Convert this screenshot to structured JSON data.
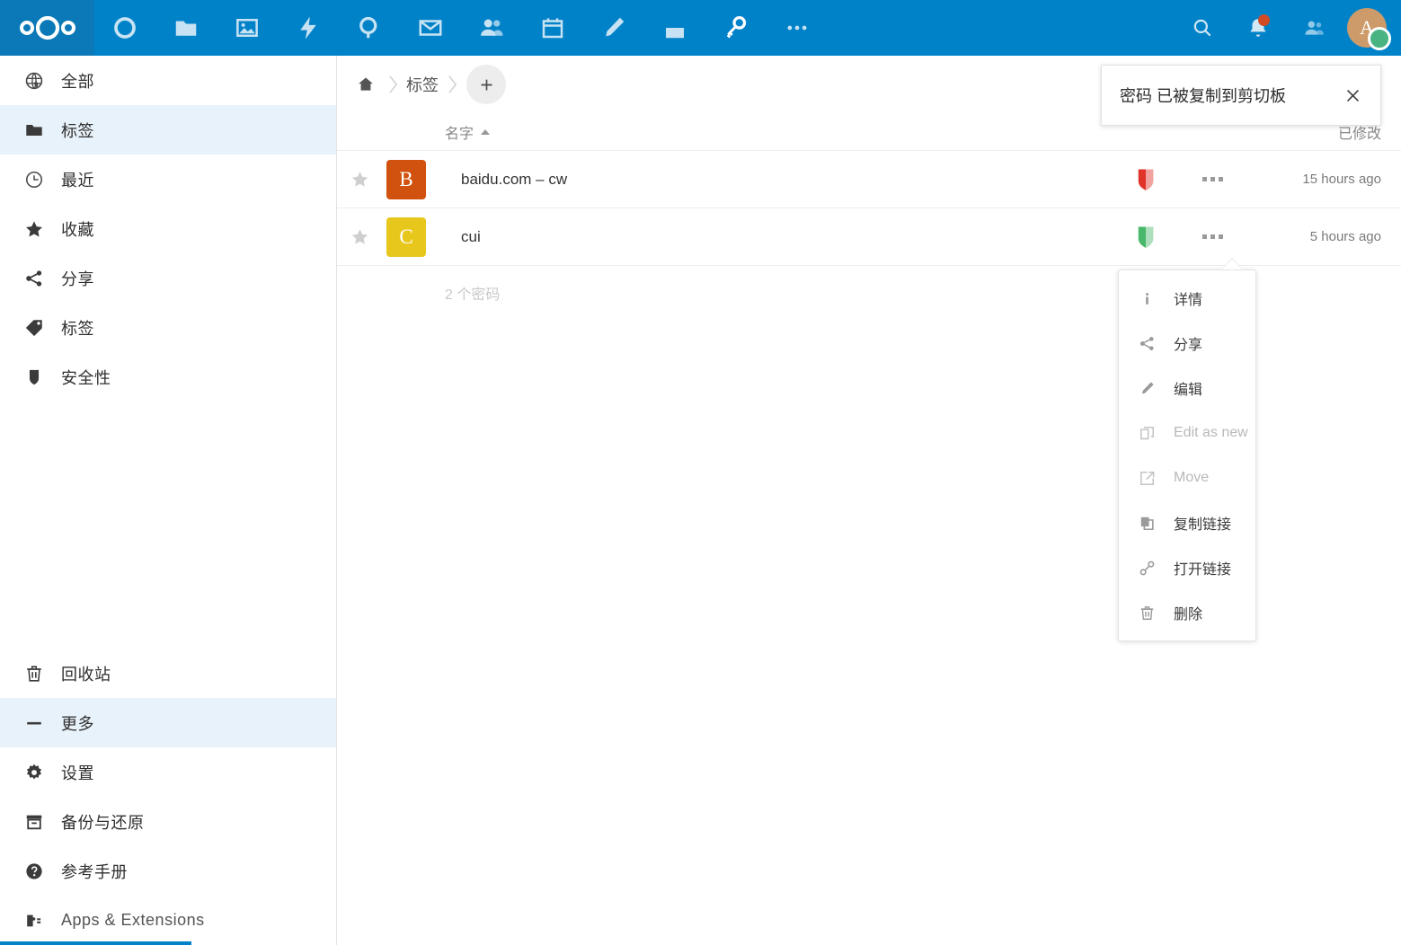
{
  "header": {
    "logo_name": "nextcloud-logo",
    "apps": [
      {
        "name": "dashboard",
        "icon": "circle-icon",
        "active": false
      },
      {
        "name": "files",
        "icon": "folder-icon",
        "active": false
      },
      {
        "name": "photos",
        "icon": "image-icon",
        "active": false
      },
      {
        "name": "activity",
        "icon": "lightning-icon",
        "active": false
      },
      {
        "name": "search",
        "icon": "magnifier-icon",
        "active": false
      },
      {
        "name": "mail",
        "icon": "envelope-icon",
        "active": false
      },
      {
        "name": "contacts",
        "icon": "people-icon",
        "active": false
      },
      {
        "name": "calendar",
        "icon": "calendar-icon",
        "active": false
      },
      {
        "name": "notes",
        "icon": "pencil-icon",
        "active": false
      },
      {
        "name": "deck",
        "icon": "deck-icon",
        "active": false
      },
      {
        "name": "passwords",
        "icon": "key-icon",
        "active": true
      },
      {
        "name": "more-apps",
        "icon": "ellipsis-icon",
        "active": false
      }
    ],
    "right": {
      "search_icon": "search-icon",
      "notifications_icon": "bell-icon",
      "notification_badge_color": "#ff4000",
      "contacts_icon": "contacts-icon",
      "avatar_letter": "A",
      "avatar_bg": "#cd9b6a",
      "status_color": "#49b382"
    },
    "bar_color": "#0082c9",
    "logo_bg_color": "#0b79b8"
  },
  "sidebar": {
    "top_items": [
      {
        "label": "全部",
        "icon": "globe-icon",
        "selected": false
      },
      {
        "label": "标签",
        "icon": "folder-icon",
        "selected": true
      },
      {
        "label": "最近",
        "icon": "clock-icon",
        "selected": false
      },
      {
        "label": "收藏",
        "icon": "star-icon",
        "selected": false
      },
      {
        "label": "分享",
        "icon": "share-icon",
        "selected": false
      },
      {
        "label": "标签",
        "icon": "tag-icon",
        "selected": false
      },
      {
        "label": "安全性",
        "icon": "shield-icon",
        "selected": false
      }
    ],
    "bottom_items": [
      {
        "label": "回收站",
        "icon": "trash-icon",
        "selected": false
      },
      {
        "label": "更多",
        "icon": "minus-icon",
        "selected": true
      },
      {
        "label": "设置",
        "icon": "gear-icon",
        "selected": false
      },
      {
        "label": "备份与还原",
        "icon": "archive-icon",
        "selected": false
      },
      {
        "label": "参考手册",
        "icon": "help-icon",
        "selected": false
      },
      {
        "label": "Apps & Extensions",
        "icon": "puzzle-icon",
        "selected": false
      }
    ]
  },
  "main": {
    "breadcrumb": {
      "home_icon": "home-icon",
      "crumb": "标签",
      "add_icon": "plus-icon"
    },
    "columns": {
      "name": "名字",
      "sort_direction": "asc",
      "modified": "已修改"
    },
    "rows": [
      {
        "favicon_letter": "B",
        "favicon_color": "#d1520e",
        "label": "baidu.com – cw",
        "security": "red",
        "security_color": "#e0342b",
        "date": "15 hours ago",
        "favorite": false
      },
      {
        "favicon_letter": "C",
        "favicon_color": "#e8c71c",
        "label": "cui",
        "security": "green",
        "security_color": "#49b86a",
        "date": "5 hours ago",
        "favorite": false
      }
    ],
    "count_label": "2 个密码"
  },
  "toast": {
    "message": "密码 已被复制到剪切板",
    "close_icon": "close-icon"
  },
  "context_menu": {
    "items": [
      {
        "label": "详情",
        "icon": "info-icon",
        "muted": false
      },
      {
        "label": "分享",
        "icon": "share-icon",
        "muted": false
      },
      {
        "label": "编辑",
        "icon": "pencil-icon",
        "muted": false
      },
      {
        "label": "Edit as new",
        "icon": "copy-new-icon",
        "muted": true
      },
      {
        "label": "Move",
        "icon": "move-icon",
        "muted": true
      },
      {
        "label": "复制链接",
        "icon": "copy-icon",
        "muted": false
      },
      {
        "label": "打开链接",
        "icon": "link-icon",
        "muted": false
      },
      {
        "label": "删除",
        "icon": "trash-icon",
        "muted": false
      }
    ]
  }
}
